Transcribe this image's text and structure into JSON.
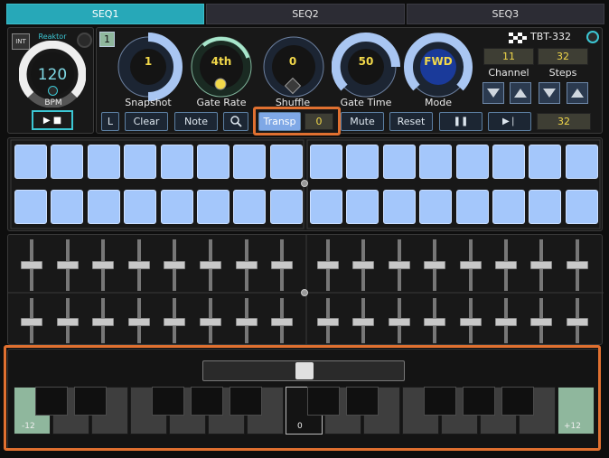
{
  "tabs": [
    {
      "label": "SEQ1",
      "active": true
    },
    {
      "label": "SEQ2",
      "active": false
    },
    {
      "label": "SEQ3",
      "active": false
    }
  ],
  "tempo": {
    "int_label": "INT",
    "brand": "Reaktor",
    "bpm_value": "120",
    "bpm_label": "BPM",
    "play_stop_label": "▶ ■"
  },
  "sequencer": {
    "slot_number": "1",
    "device_name": "TBT-332",
    "knobs": [
      {
        "name": "Snapshot",
        "value": "1"
      },
      {
        "name": "Gate Rate",
        "value": "4th"
      },
      {
        "name": "Shuffle",
        "value": "0"
      },
      {
        "name": "Gate Time",
        "value": "50"
      },
      {
        "name": "Mode",
        "value": "FWD"
      }
    ],
    "channel_label": "Channel",
    "channel_value": "11",
    "steps_label": "Steps",
    "steps_value": "32",
    "buttons": {
      "l": "L",
      "clear": "Clear",
      "note": "Note",
      "transp": "Transp",
      "transp_value": "0",
      "mute": "Mute",
      "reset": "Reset",
      "pause": "❚❚",
      "next": "▶❘",
      "length_value": "32"
    }
  },
  "keyboard": {
    "low_label": "-12",
    "center_label": "0",
    "high_label": "+12"
  },
  "colors": {
    "accent": "#27a8b8",
    "pad": "#a4c7fb",
    "value_text": "#f2d84a",
    "highlight": "#e07030"
  }
}
